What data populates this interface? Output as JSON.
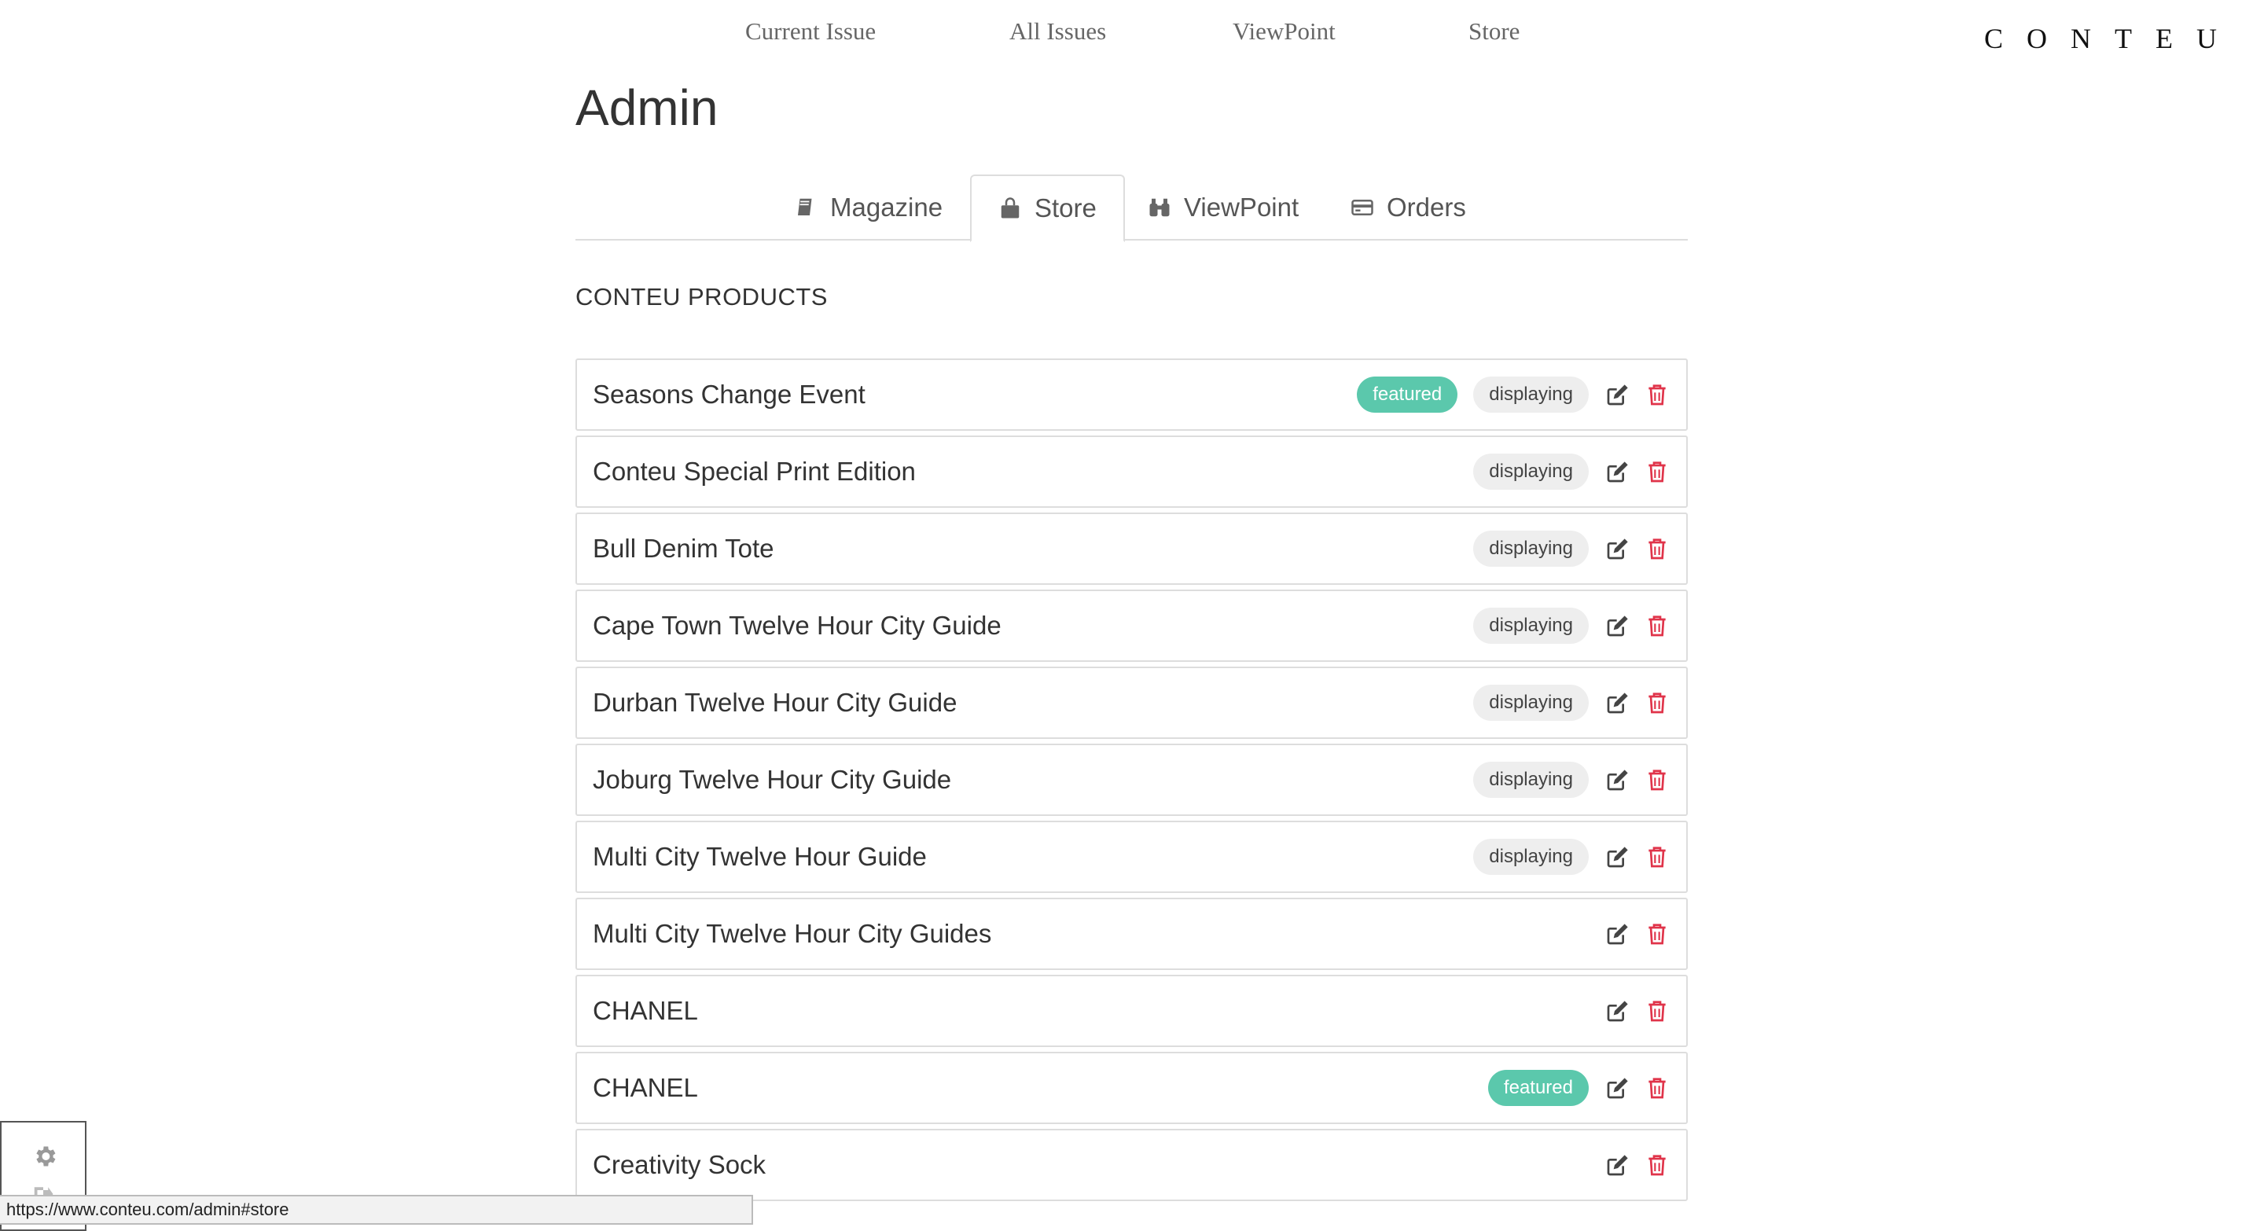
{
  "topnav": {
    "items": [
      {
        "label": "Current Issue"
      },
      {
        "label": "All Issues"
      },
      {
        "label": "ViewPoint"
      },
      {
        "label": "Store"
      }
    ],
    "brand": "CONTEU"
  },
  "page_title": "Admin",
  "tabs": [
    {
      "label": "Magazine",
      "icon": "book-icon"
    },
    {
      "label": "Store",
      "icon": "shopping-bag-icon",
      "active": true
    },
    {
      "label": "ViewPoint",
      "icon": "binoculars-icon"
    },
    {
      "label": "Orders",
      "icon": "credit-card-icon"
    }
  ],
  "section_title": "CONTEU PRODUCTS",
  "colors": {
    "featured": "#5bc8ac",
    "displaying_bg": "#eeeeee",
    "delete": "#e0344a",
    "border": "#dddddd"
  },
  "badges": {
    "featured": "featured",
    "displaying": "displaying"
  },
  "products": [
    {
      "name": "Seasons Change Event",
      "featured": true,
      "displaying": true
    },
    {
      "name": "Conteu Special Print Edition",
      "featured": false,
      "displaying": true
    },
    {
      "name": "Bull Denim Tote",
      "featured": false,
      "displaying": true
    },
    {
      "name": "Cape Town Twelve Hour City Guide",
      "featured": false,
      "displaying": true
    },
    {
      "name": "Durban Twelve Hour City Guide",
      "featured": false,
      "displaying": true
    },
    {
      "name": "Joburg Twelve Hour City Guide",
      "featured": false,
      "displaying": true
    },
    {
      "name": "Multi City Twelve Hour Guide",
      "featured": false,
      "displaying": true
    },
    {
      "name": "Multi City Twelve Hour City Guides",
      "featured": false,
      "displaying": false
    },
    {
      "name": "CHANEL",
      "featured": false,
      "displaying": false
    },
    {
      "name": "CHANEL",
      "featured": true,
      "displaying": false
    },
    {
      "name": "Creativity Sock",
      "featured": false,
      "displaying": false
    }
  ],
  "statusbar": {
    "url": "https://www.conteu.com/admin#store"
  }
}
